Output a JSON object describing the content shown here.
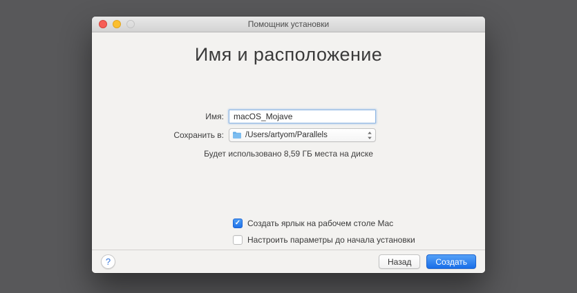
{
  "window": {
    "title": "Помощник установки"
  },
  "heading": "Имя и расположение",
  "form": {
    "name_label": "Имя:",
    "name_value": "macOS_Mojave",
    "location_label": "Сохранить в:",
    "location_value": "/Users/artyom/Parallels",
    "location_icon": "folder-icon",
    "disk_usage_note": "Будет использовано 8,59 ГБ места на диске"
  },
  "options": [
    {
      "label": "Создать ярлык на рабочем столе Mac",
      "checked": true,
      "check_glyph": "✓"
    },
    {
      "label": "Настроить параметры до начала установки",
      "checked": false,
      "check_glyph": ""
    }
  ],
  "footer": {
    "help_label": "?",
    "back_label": "Назад",
    "create_label": "Создать"
  },
  "colors": {
    "accent_blue": "#1f72e8",
    "desktop_background": "#58585a",
    "window_background": "#f3f2f0"
  }
}
